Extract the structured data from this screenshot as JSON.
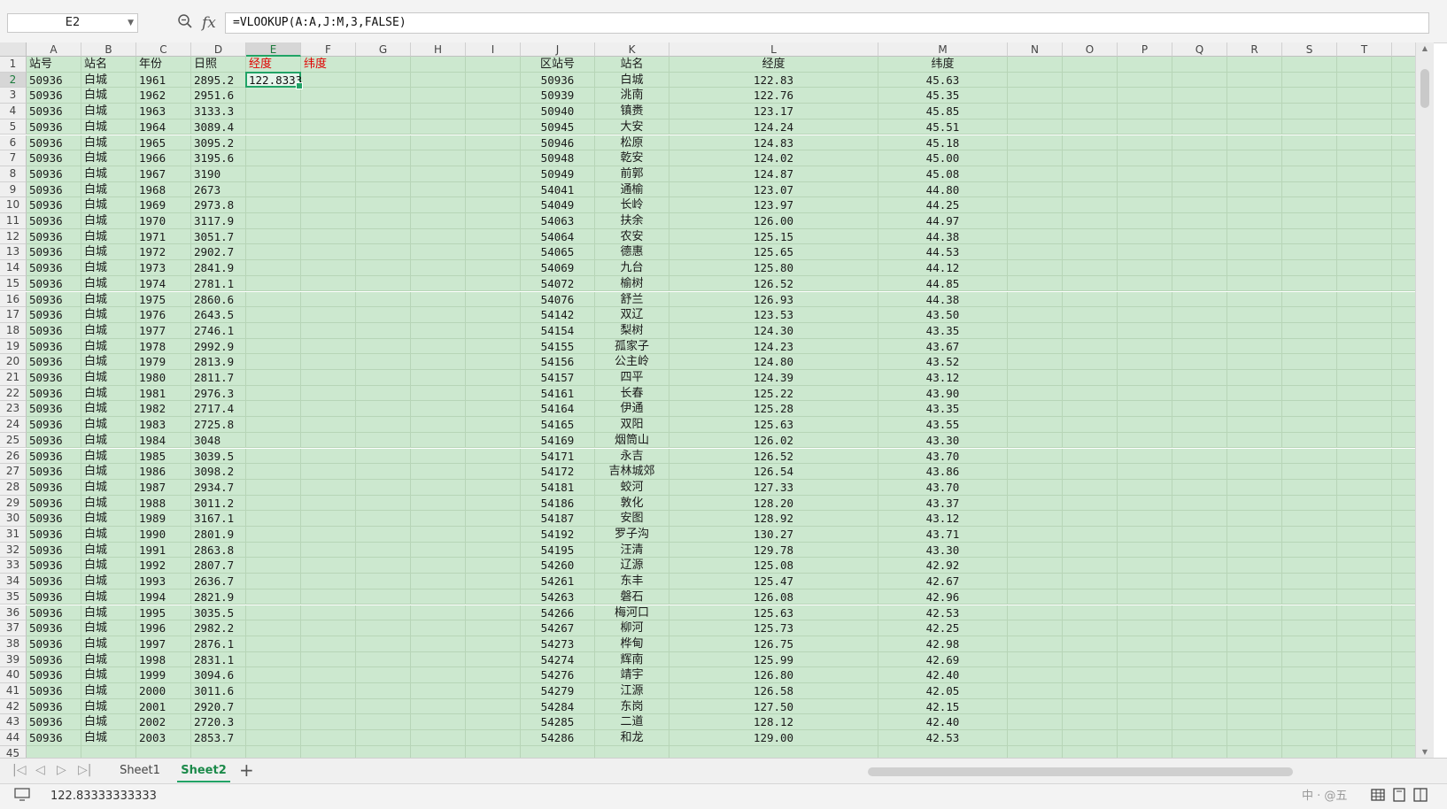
{
  "formula_bar": {
    "cell_ref": "E2",
    "formula": "=VLOOKUP(A:A,J:M,3,FALSE)",
    "zoom_icon": "zoom-icon",
    "fx_label": "fx"
  },
  "columns": [
    "A",
    "B",
    "C",
    "D",
    "E",
    "F",
    "G",
    "H",
    "I",
    "J",
    "K",
    "L",
    "M",
    "N",
    "O",
    "P",
    "Q",
    "R",
    "S",
    "T",
    "U"
  ],
  "active_cell": {
    "col": "E",
    "row": 2
  },
  "header_row": {
    "A": "站号",
    "B": "站名",
    "C": "年份",
    "D": "日照",
    "E": "经度",
    "F": "纬度",
    "J": "区站号",
    "K": "站名",
    "L": "经度",
    "M": "纬度"
  },
  "e2_value": "122.8333",
  "left_table": [
    [
      "50936",
      "白城",
      "1961",
      "2895.2"
    ],
    [
      "50936",
      "白城",
      "1962",
      "2951.6"
    ],
    [
      "50936",
      "白城",
      "1963",
      "3133.3"
    ],
    [
      "50936",
      "白城",
      "1964",
      "3089.4"
    ],
    [
      "50936",
      "白城",
      "1965",
      "3095.2"
    ],
    [
      "50936",
      "白城",
      "1966",
      "3195.6"
    ],
    [
      "50936",
      "白城",
      "1967",
      "3190"
    ],
    [
      "50936",
      "白城",
      "1968",
      "2673"
    ],
    [
      "50936",
      "白城",
      "1969",
      "2973.8"
    ],
    [
      "50936",
      "白城",
      "1970",
      "3117.9"
    ],
    [
      "50936",
      "白城",
      "1971",
      "3051.7"
    ],
    [
      "50936",
      "白城",
      "1972",
      "2902.7"
    ],
    [
      "50936",
      "白城",
      "1973",
      "2841.9"
    ],
    [
      "50936",
      "白城",
      "1974",
      "2781.1"
    ],
    [
      "50936",
      "白城",
      "1975",
      "2860.6"
    ],
    [
      "50936",
      "白城",
      "1976",
      "2643.5"
    ],
    [
      "50936",
      "白城",
      "1977",
      "2746.1"
    ],
    [
      "50936",
      "白城",
      "1978",
      "2992.9"
    ],
    [
      "50936",
      "白城",
      "1979",
      "2813.9"
    ],
    [
      "50936",
      "白城",
      "1980",
      "2811.7"
    ],
    [
      "50936",
      "白城",
      "1981",
      "2976.3"
    ],
    [
      "50936",
      "白城",
      "1982",
      "2717.4"
    ],
    [
      "50936",
      "白城",
      "1983",
      "2725.8"
    ],
    [
      "50936",
      "白城",
      "1984",
      "3048"
    ],
    [
      "50936",
      "白城",
      "1985",
      "3039.5"
    ],
    [
      "50936",
      "白城",
      "1986",
      "3098.2"
    ],
    [
      "50936",
      "白城",
      "1987",
      "2934.7"
    ],
    [
      "50936",
      "白城",
      "1988",
      "3011.2"
    ],
    [
      "50936",
      "白城",
      "1989",
      "3167.1"
    ],
    [
      "50936",
      "白城",
      "1990",
      "2801.9"
    ],
    [
      "50936",
      "白城",
      "1991",
      "2863.8"
    ],
    [
      "50936",
      "白城",
      "1992",
      "2807.7"
    ],
    [
      "50936",
      "白城",
      "1993",
      "2636.7"
    ],
    [
      "50936",
      "白城",
      "1994",
      "2821.9"
    ],
    [
      "50936",
      "白城",
      "1995",
      "3035.5"
    ],
    [
      "50936",
      "白城",
      "1996",
      "2982.2"
    ],
    [
      "50936",
      "白城",
      "1997",
      "2876.1"
    ],
    [
      "50936",
      "白城",
      "1998",
      "2831.1"
    ],
    [
      "50936",
      "白城",
      "1999",
      "3094.6"
    ],
    [
      "50936",
      "白城",
      "2000",
      "3011.6"
    ],
    [
      "50936",
      "白城",
      "2001",
      "2920.7"
    ],
    [
      "50936",
      "白城",
      "2002",
      "2720.3"
    ],
    [
      "50936",
      "白城",
      "2003",
      "2853.7"
    ]
  ],
  "right_table": [
    [
      "50936",
      "白城",
      "122.83",
      "45.63"
    ],
    [
      "50939",
      "洮南",
      "122.76",
      "45.35"
    ],
    [
      "50940",
      "镇赉",
      "123.17",
      "45.85"
    ],
    [
      "50945",
      "大安",
      "124.24",
      "45.51"
    ],
    [
      "50946",
      "松原",
      "124.83",
      "45.18"
    ],
    [
      "50948",
      "乾安",
      "124.02",
      "45.00"
    ],
    [
      "50949",
      "前郭",
      "124.87",
      "45.08"
    ],
    [
      "54041",
      "通榆",
      "123.07",
      "44.80"
    ],
    [
      "54049",
      "长岭",
      "123.97",
      "44.25"
    ],
    [
      "54063",
      "扶余",
      "126.00",
      "44.97"
    ],
    [
      "54064",
      "农安",
      "125.15",
      "44.38"
    ],
    [
      "54065",
      "德惠",
      "125.65",
      "44.53"
    ],
    [
      "54069",
      "九台",
      "125.80",
      "44.12"
    ],
    [
      "54072",
      "榆树",
      "126.52",
      "44.85"
    ],
    [
      "54076",
      "舒兰",
      "126.93",
      "44.38"
    ],
    [
      "54142",
      "双辽",
      "123.53",
      "43.50"
    ],
    [
      "54154",
      "梨树",
      "124.30",
      "43.35"
    ],
    [
      "54155",
      "孤家子",
      "124.23",
      "43.67"
    ],
    [
      "54156",
      "公主岭",
      "124.80",
      "43.52"
    ],
    [
      "54157",
      "四平",
      "124.39",
      "43.12"
    ],
    [
      "54161",
      "长春",
      "125.22",
      "43.90"
    ],
    [
      "54164",
      "伊通",
      "125.28",
      "43.35"
    ],
    [
      "54165",
      "双阳",
      "125.63",
      "43.55"
    ],
    [
      "54169",
      "烟筒山",
      "126.02",
      "43.30"
    ],
    [
      "54171",
      "永吉",
      "126.52",
      "43.70"
    ],
    [
      "54172",
      "吉林城郊",
      "126.54",
      "43.86"
    ],
    [
      "54181",
      "蛟河",
      "127.33",
      "43.70"
    ],
    [
      "54186",
      "敦化",
      "128.20",
      "43.37"
    ],
    [
      "54187",
      "安图",
      "128.92",
      "43.12"
    ],
    [
      "54192",
      "罗子沟",
      "130.27",
      "43.71"
    ],
    [
      "54195",
      "汪清",
      "129.78",
      "43.30"
    ],
    [
      "54260",
      "辽源",
      "125.08",
      "42.92"
    ],
    [
      "54261",
      "东丰",
      "125.47",
      "42.67"
    ],
    [
      "54263",
      "磐石",
      "126.08",
      "42.96"
    ],
    [
      "54266",
      "梅河口",
      "125.63",
      "42.53"
    ],
    [
      "54267",
      "柳河",
      "125.73",
      "42.25"
    ],
    [
      "54273",
      "桦甸",
      "126.75",
      "42.98"
    ],
    [
      "54274",
      "辉南",
      "125.99",
      "42.69"
    ],
    [
      "54276",
      "靖宇",
      "126.80",
      "42.40"
    ],
    [
      "54279",
      "江源",
      "126.58",
      "42.05"
    ],
    [
      "54284",
      "东岗",
      "127.50",
      "42.15"
    ],
    [
      "54285",
      "二道",
      "128.12",
      "42.40"
    ],
    [
      "54286",
      "和龙",
      "129.00",
      "42.53"
    ]
  ],
  "sheet_tabs": [
    "Sheet1",
    "Sheet2"
  ],
  "active_tab": "Sheet2",
  "status": {
    "value": "122.83333333333",
    "watermark": "中 · @五"
  }
}
